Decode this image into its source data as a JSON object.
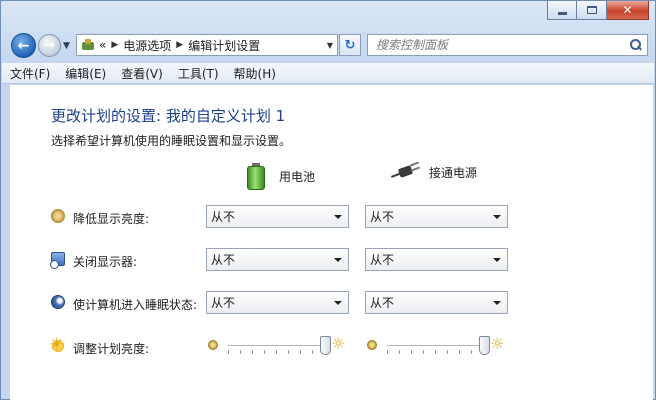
{
  "window": {
    "caption": {
      "minimize": "minimize",
      "maximize": "maximize",
      "close": "✕"
    }
  },
  "nav": {
    "address": {
      "overflow": "«",
      "crumbs": [
        "电源选项",
        "编辑计划设置"
      ]
    },
    "search_placeholder": "搜索控制面板"
  },
  "menu": [
    "文件(F)",
    "编辑(E)",
    "查看(V)",
    "工具(T)",
    "帮助(H)"
  ],
  "page": {
    "title": "更改计划的设置: 我的自定义计划 1",
    "subtitle": "选择希望计算机使用的睡眠设置和显示设置。",
    "columns": {
      "battery": "用电池",
      "plugged": "接通电源"
    }
  },
  "settings": [
    {
      "label": "降低显示亮度:",
      "battery": "从不",
      "plugged": "从不",
      "icon": "dim-display-icon"
    },
    {
      "label": "关闭显示器:",
      "battery": "从不",
      "plugged": "从不",
      "icon": "display-off-icon"
    },
    {
      "label": "使计算机进入睡眠状态:",
      "battery": "从不",
      "plugged": "从不",
      "icon": "sleep-icon"
    }
  ],
  "brightness": {
    "label": "调整计划亮度:",
    "battery_level": 1.0,
    "plugged_level": 1.0,
    "icon": "brightness-sun-icon"
  },
  "colors": {
    "title": "#1e3f8c",
    "accent": "#2163b7",
    "battery": "#4fa62e",
    "close_button": "#c7432c"
  }
}
